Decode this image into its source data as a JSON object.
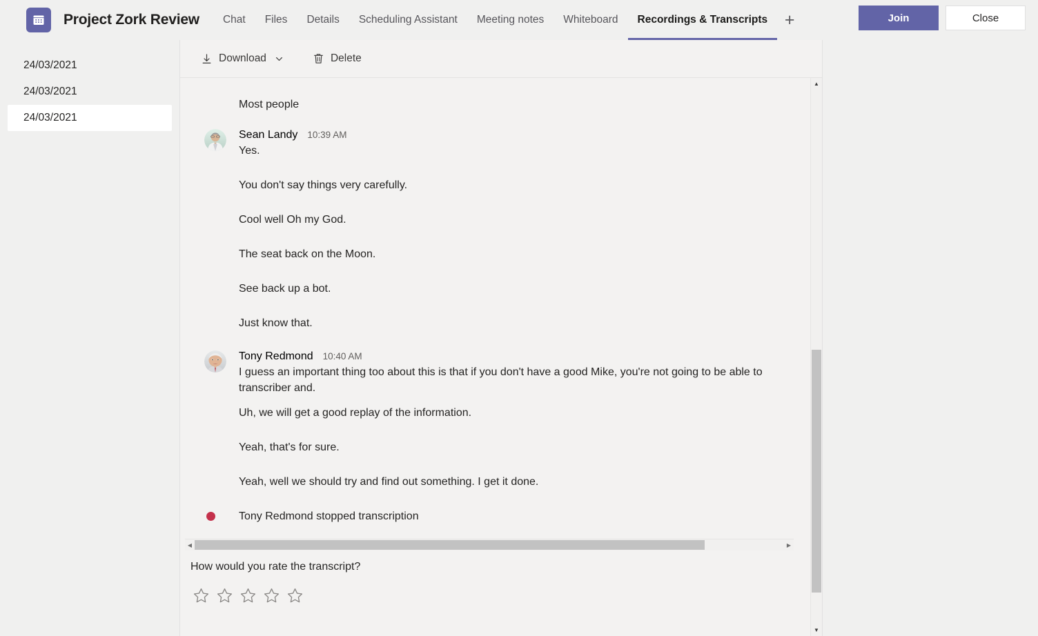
{
  "header": {
    "app_icon": "calendar-icon",
    "title": "Project Zork Review",
    "tabs": [
      {
        "label": "Chat",
        "active": false
      },
      {
        "label": "Files",
        "active": false
      },
      {
        "label": "Details",
        "active": false
      },
      {
        "label": "Scheduling Assistant",
        "active": false
      },
      {
        "label": "Meeting notes",
        "active": false
      },
      {
        "label": "Whiteboard",
        "active": false
      },
      {
        "label": "Recordings & Transcripts",
        "active": true
      }
    ],
    "add_tab_label": "+",
    "join_label": "Join",
    "close_label": "Close",
    "accent_color": "#6264a7"
  },
  "sidebar": {
    "items": [
      {
        "label": "24/03/2021",
        "selected": false
      },
      {
        "label": "24/03/2021",
        "selected": false
      },
      {
        "label": "24/03/2021",
        "selected": true
      }
    ]
  },
  "toolbar": {
    "download_label": "Download",
    "download_icon": "download-arrow-icon",
    "download_chevron": "chevron-down-icon",
    "delete_label": "Delete",
    "delete_icon": "trash-icon"
  },
  "transcript": {
    "partial_first_line": "Most people",
    "entries": [
      {
        "speaker": "Sean Landy",
        "time": "10:39 AM",
        "avatar": "sean-landy-avatar",
        "lines": [
          "Yes.",
          "You don't say things very carefully.",
          "Cool well Oh my God.",
          "The seat back on the Moon.",
          "See back up a bot.",
          "Just know that."
        ]
      },
      {
        "speaker": "Tony Redmond",
        "time": "10:40 AM",
        "avatar": "tony-redmond-avatar",
        "lines": [
          "I guess an important thing too about this is that if you don't have a good Mike, you're not going to be able to transcriber and.",
          "Uh, we will get a good replay of the information.",
          "Yeah, that's for sure.",
          "Yeah, well we should try and find out something. I get it done."
        ]
      }
    ],
    "event": {
      "text": "Tony Redmond stopped transcription",
      "dot_color": "#c4314b"
    }
  },
  "rating": {
    "question": "How would you rate the transcript?",
    "stars": [
      "☆",
      "☆",
      "☆",
      "☆",
      "☆"
    ],
    "value": 0,
    "max": 5
  },
  "scrollbars": {
    "horizontal_left_arrow": "◀",
    "horizontal_right_arrow": "▶",
    "vertical_up_arrow": "▲",
    "vertical_down_arrow": "▼"
  }
}
